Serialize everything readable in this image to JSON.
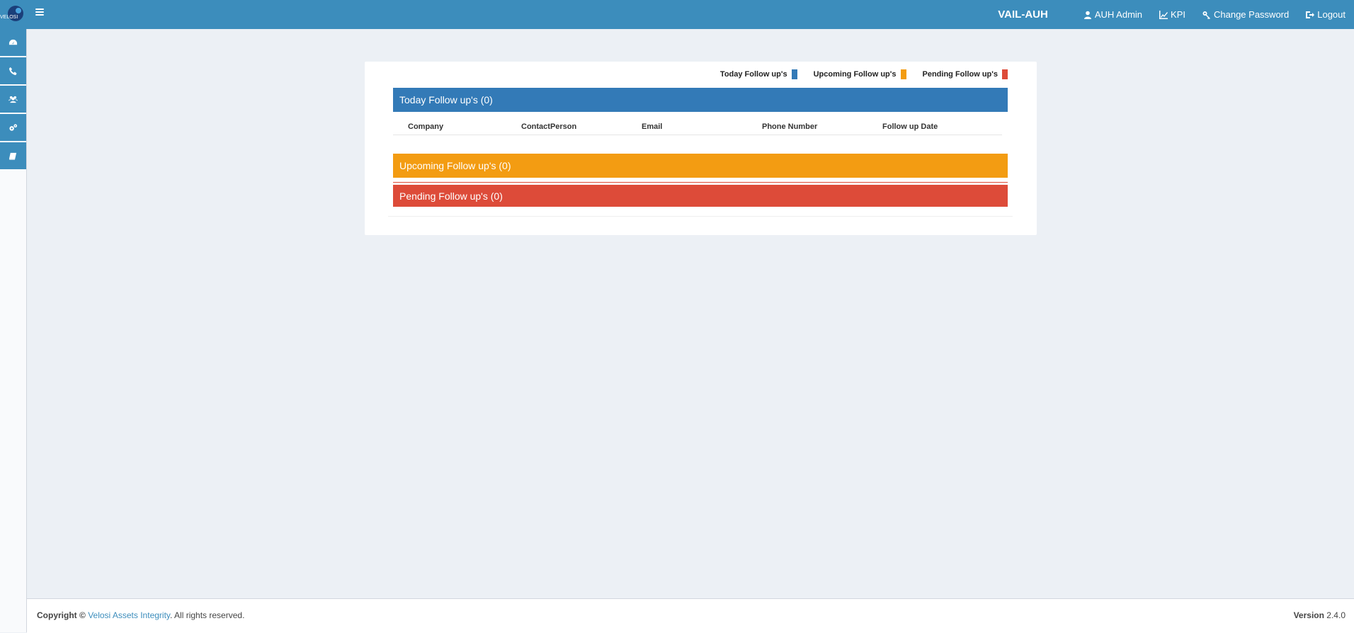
{
  "header": {
    "logo_text": "VELOSI",
    "company_code": "VAIL-AUH",
    "user_label": "AUH Admin",
    "kpi_label": "KPI",
    "change_password_label": "Change Password",
    "logout_label": "Logout",
    "bar_color": "#3c8dbc"
  },
  "sidebar": {
    "items": [
      {
        "icon": "dashboard-icon"
      },
      {
        "icon": "phone-icon"
      },
      {
        "icon": "users-icon"
      },
      {
        "icon": "cogs-icon"
      },
      {
        "icon": "book-icon"
      }
    ]
  },
  "legend": {
    "today": "Today Follow up's",
    "upcoming": "Upcoming Follow up's",
    "pending": "Pending Follow up's",
    "colors": {
      "today": "#337ab7",
      "upcoming": "#f39c12",
      "pending": "#dd4b39"
    }
  },
  "sections": {
    "today_title": "Today Follow up's (0)",
    "upcoming_title": "Upcoming Follow up's (0)",
    "pending_title": "Pending Follow up's (0)"
  },
  "table": {
    "columns": [
      "Company",
      "ContactPerson",
      "Email",
      "Phone Number",
      "Follow up Date"
    ]
  },
  "footer": {
    "copyright_label": "Copyright ©",
    "company_link": "Velosi Assets Integrity",
    "rights": ". All rights reserved.",
    "version_label": "Version",
    "version_value": "2.4.0"
  }
}
